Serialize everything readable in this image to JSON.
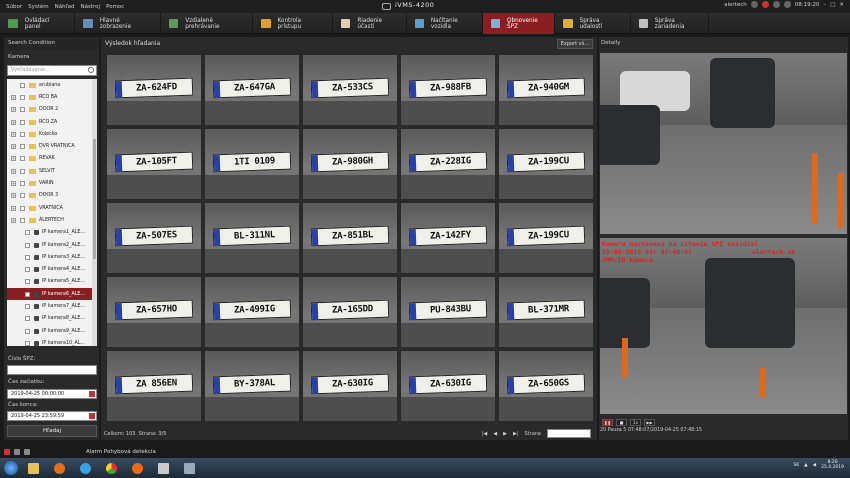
{
  "menu": [
    "Súbor",
    "Systém",
    "Náhľad",
    "Nástroj",
    "Pomoc"
  ],
  "app_title": "iVMS-4200",
  "user": "alertech",
  "clock_top": "08:19:20",
  "tabs": [
    {
      "label": "Ovládací panel",
      "icon": "grid-icon",
      "color": "#4a9d4a"
    },
    {
      "label": "Hlavné zobrazenie",
      "icon": "monitor-icon",
      "color": "#6a8bb5"
    },
    {
      "label": "Vzdialené prehrávanie",
      "icon": "playback-icon",
      "color": "#5a9a5a"
    },
    {
      "label": "Kontrola prístupu",
      "icon": "door-icon",
      "color": "#e0a030"
    },
    {
      "label": "Riadenie účasti",
      "icon": "attendance-icon",
      "color": "#e0d0b0"
    },
    {
      "label": "Načítanie vozidla",
      "icon": "vehicle-icon",
      "color": "#5aa0d0"
    },
    {
      "label": "Obnovenie ŠPZ",
      "icon": "plate-icon",
      "color": "#7ab0e0",
      "active": true
    },
    {
      "label": "Správa udalostí",
      "icon": "event-icon",
      "color": "#e0b030"
    },
    {
      "label": "Správa zariadenia",
      "icon": "device-icon",
      "color": "#c0c0c0"
    }
  ],
  "left": {
    "header": "Search Condition",
    "camera_label": "Kamera",
    "search_placeholder": "Vyhľadávanie...",
    "tree": [
      {
        "label": "arubiana",
        "type": "folder",
        "exp": false
      },
      {
        "label": "RCO BA",
        "type": "folder",
        "exp": true
      },
      {
        "label": "DOOR 2",
        "type": "folder",
        "exp": true
      },
      {
        "label": "RCO ZA",
        "type": "folder",
        "exp": true
      },
      {
        "label": "Kolecko",
        "type": "folder",
        "exp": true
      },
      {
        "label": "DVR VRATNICA",
        "type": "folder",
        "exp": true
      },
      {
        "label": "REVAK",
        "type": "folder",
        "exp": true
      },
      {
        "label": "SELVIT",
        "type": "folder",
        "exp": true
      },
      {
        "label": "VARIN",
        "type": "folder",
        "exp": true
      },
      {
        "label": "DOOR 3",
        "type": "folder",
        "exp": true
      },
      {
        "label": "VRATNICA",
        "type": "folder",
        "exp": true
      },
      {
        "label": "ALERTECH",
        "type": "folder",
        "exp": true
      },
      {
        "label": "IP kamera1_ALE...",
        "type": "camera"
      },
      {
        "label": "IP kamera2_ALE...",
        "type": "camera"
      },
      {
        "label": "IP kamera3_ALE...",
        "type": "camera"
      },
      {
        "label": "IP kamera4_ALE...",
        "type": "camera"
      },
      {
        "label": "IP kamera5_ALE...",
        "type": "camera"
      },
      {
        "label": "IP kamera6_ALE...",
        "type": "camera",
        "selected": true
      },
      {
        "label": "IP kamera7_ALE...",
        "type": "camera"
      },
      {
        "label": "IP kamera8_ALE...",
        "type": "camera"
      },
      {
        "label": "IP kamera9_ALE...",
        "type": "camera"
      },
      {
        "label": "IP kamera10_AL...",
        "type": "camera"
      }
    ],
    "plate_label": "Číslo ŠPZ:",
    "plate_value": "",
    "start_label": "Čas začiatku:",
    "start_value": "2019-04-25 00:00:00",
    "end_label": "Čas konca:",
    "end_value": "2019-04-25 23:59:59",
    "search_button": "Hľadaj"
  },
  "mid": {
    "header": "Výsledok hľadania",
    "export": "Export vš...",
    "plates": [
      "ZA-624FD",
      "ZA-647GA",
      "ZA-533CS",
      "ZA-988FB",
      "ZA-940GM",
      "ZA-105FT",
      "1TI 0109",
      "ZA-980GH",
      "ZA-228IG",
      "ZA-199CU",
      "ZA-507ES",
      "BL-311NL",
      "ZA-851BL",
      "ZA-142FY",
      "ZA-199CU",
      "ZA-657HO",
      "ZA-499IG",
      "ZA-165DD",
      "PU-843BU",
      "BL-371MR",
      "ZA 856EN",
      "BY-378AL",
      "ZA-630IG",
      "ZA-630IG",
      "ZA-650GS"
    ],
    "highlight_index": 18,
    "total_label": "Celkom:",
    "total": "103",
    "page_label": "Strana:",
    "page": "3/5",
    "nav": [
      "|◀",
      "◀",
      "▶",
      "▶|"
    ],
    "page_input_label": "Strana"
  },
  "right": {
    "header": "Detaily",
    "overlay_lines": [
      "Kamera nastavena na citanie SPZ vozidiel",
      "25-04-2019 Str 07:48:07",
      "alertech.sk",
      "2MP/IR kamera"
    ],
    "controls": [
      "❚❚",
      "■",
      "1x",
      "▶▶"
    ],
    "time": "20 Pauza 5 07:48:07/2019-04-25 07:48:15"
  },
  "status": {
    "alarm": "Alarm Pohybová detekcia"
  },
  "taskbar": {
    "lang": "SK",
    "time": "8:20",
    "date": "25.4.2019"
  }
}
